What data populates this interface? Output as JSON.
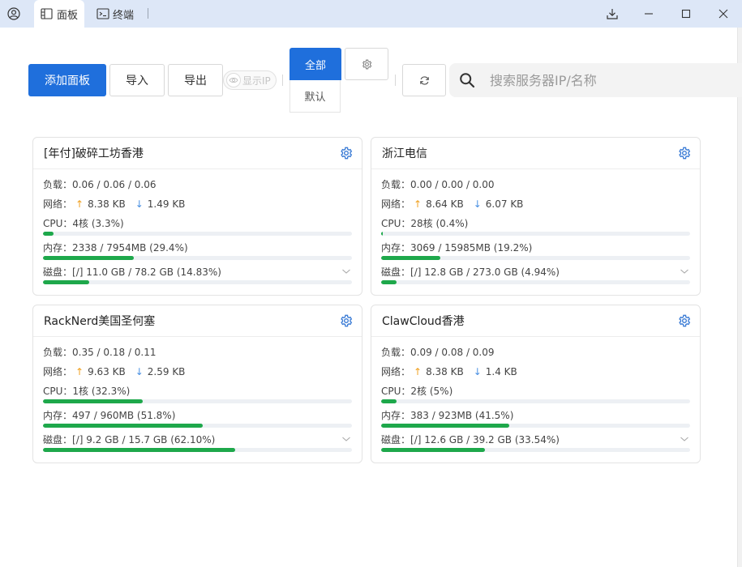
{
  "titlebar": {
    "tabs": [
      {
        "label": "面板",
        "icon": "panel-icon",
        "active": true
      },
      {
        "label": "终端",
        "icon": "terminal-icon",
        "active": false
      }
    ],
    "buttons": [
      "download-icon",
      "minimize-icon",
      "maximize-icon",
      "close-icon"
    ]
  },
  "toolbar": {
    "add_label": "添加面板",
    "import_label": "导入",
    "export_label": "导出",
    "show_ip_label": "显示IP",
    "show_ip_on": false,
    "group_all_label": "全部",
    "group_default_label": "默认",
    "search_placeholder": "搜索服务器IP/名称",
    "search_value": ""
  },
  "colors": {
    "accent": "#1f6fdc",
    "bar_fill": "#1ea84b",
    "bar_track": "#edf0f4",
    "up_arrow": "#f0a020",
    "down_arrow": "#4a90e2",
    "gear": "#3a7bd5"
  },
  "servers": [
    {
      "name": "[年付]破碎工坊香港",
      "load_label": "负载：",
      "load": "0.06 / 0.06 / 0.06",
      "net_label": "网络：",
      "up": "8.38 KB",
      "down": "1.49 KB",
      "cpu_label": "CPU：",
      "cpu": "4核 (3.3%)",
      "cpu_pct": 3.3,
      "mem_label": "内存：",
      "mem": "2338 / 7954MB (29.4%)",
      "mem_pct": 29.4,
      "disk_label": "磁盘：",
      "disk": "[/] 11.0 GB / 78.2 GB (14.83%)",
      "disk_pct": 14.83
    },
    {
      "name": "浙江电信",
      "load_label": "负载：",
      "load": "0.00 / 0.00 / 0.00",
      "net_label": "网络：",
      "up": "8.64 KB",
      "down": "6.07 KB",
      "cpu_label": "CPU：",
      "cpu": "28核 (0.4%)",
      "cpu_pct": 0.4,
      "mem_label": "内存：",
      "mem": "3069 / 15985MB (19.2%)",
      "mem_pct": 19.2,
      "disk_label": "磁盘：",
      "disk": "[/] 12.8 GB / 273.0 GB (4.94%)",
      "disk_pct": 4.94
    },
    {
      "name": "RackNerd美国圣何塞",
      "load_label": "负载：",
      "load": "0.35 / 0.18 / 0.11",
      "net_label": "网络：",
      "up": "9.63 KB",
      "down": "2.59 KB",
      "cpu_label": "CPU：",
      "cpu": "1核 (32.3%)",
      "cpu_pct": 32.3,
      "mem_label": "内存：",
      "mem": "497 / 960MB (51.8%)",
      "mem_pct": 51.8,
      "disk_label": "磁盘：",
      "disk": "[/] 9.2 GB / 15.7 GB (62.10%)",
      "disk_pct": 62.1
    },
    {
      "name": "ClawCloud香港",
      "load_label": "负载：",
      "load": "0.09 / 0.08 / 0.09",
      "net_label": "网络：",
      "up": "8.38 KB",
      "down": "1.4 KB",
      "cpu_label": "CPU：",
      "cpu": "2核 (5%)",
      "cpu_pct": 5,
      "mem_label": "内存：",
      "mem": "383 / 923MB (41.5%)",
      "mem_pct": 41.5,
      "disk_label": "磁盘：",
      "disk": "[/] 12.6 GB / 39.2 GB (33.54%)",
      "disk_pct": 33.54
    }
  ]
}
